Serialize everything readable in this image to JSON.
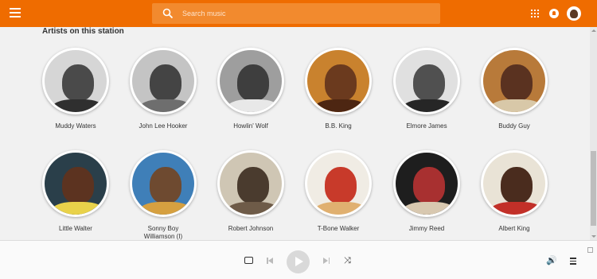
{
  "search": {
    "placeholder": "Search music"
  },
  "section": {
    "title": "Artists on this station"
  },
  "artists": [
    {
      "name": "Muddy Waters",
      "bg": "#d6d6d6",
      "face": "#4a4a4a",
      "body": "#2f2f2f"
    },
    {
      "name": "John Lee Hooker",
      "bg": "#c4c4c4",
      "face": "#444444",
      "body": "#6e6e6e"
    },
    {
      "name": "Howlin' Wolf",
      "bg": "#9e9e9e",
      "face": "#3e3e3e",
      "body": "#e8e8e8"
    },
    {
      "name": "B.B. King",
      "bg": "#c9822e",
      "face": "#6b3a1e",
      "body": "#4d2612"
    },
    {
      "name": "Elmore James",
      "bg": "#e0e0e0",
      "face": "#505050",
      "body": "#262626"
    },
    {
      "name": "Buddy Guy",
      "bg": "#b87a3a",
      "face": "#5a3220",
      "body": "#d8c8a8"
    },
    {
      "name": "Little Walter",
      "bg": "#2a3f4a",
      "face": "#5c3320",
      "body": "#e9d24a"
    },
    {
      "name": "Sonny Boy Williamson (I)",
      "bg": "#3f7fb8",
      "face": "#6e4a30",
      "body": "#d6a040"
    },
    {
      "name": "Robert Johnson",
      "bg": "#cfc6b4",
      "face": "#4a3b2e",
      "body": "#6e5b48"
    },
    {
      "name": "T-Bone Walker",
      "bg": "#f0ece4",
      "face": "#c83a2a",
      "body": "#e0b070"
    },
    {
      "name": "Jimmy Reed",
      "bg": "#1e1e1e",
      "face": "#a83030",
      "body": "#d8c8b0"
    },
    {
      "name": "Albert King",
      "bg": "#e9e3d6",
      "face": "#4a2c1e",
      "body": "#c23028"
    }
  ],
  "colors": {
    "accent": "#ef6c00"
  },
  "player": {
    "repeat_icon": "repeat-icon",
    "prev_icon": "skip-previous-icon",
    "play_icon": "play-icon",
    "next_icon": "skip-next-icon",
    "shuffle_icon": "shuffle-icon",
    "volume_icon": "volume-icon",
    "queue_icon": "queue-icon"
  }
}
